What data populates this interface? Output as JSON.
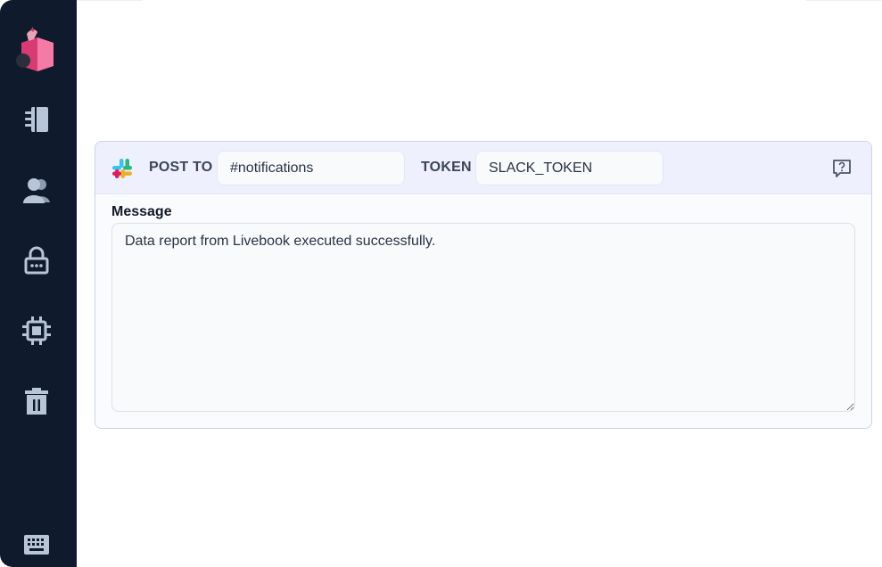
{
  "sidebar": {
    "items": [
      {
        "icon": "notebook-icon"
      },
      {
        "icon": "users-icon"
      },
      {
        "icon": "lock-icon"
      },
      {
        "icon": "cpu-icon"
      },
      {
        "icon": "trash-icon"
      },
      {
        "icon": "keyboard-icon"
      }
    ]
  },
  "cell": {
    "post_to_label": "POST TO",
    "channel_value": "#notifications",
    "token_label": "TOKEN",
    "token_value": "SLACK_TOKEN",
    "message_label": "Message",
    "message_value": "Data report from Livebook executed successfully."
  },
  "colors": {
    "sidebar_bg": "#0f1b2d",
    "sidebar_icon": "#b8c4d8",
    "header_bg": "#eef1fd",
    "logo_pink": "#f2699a"
  }
}
